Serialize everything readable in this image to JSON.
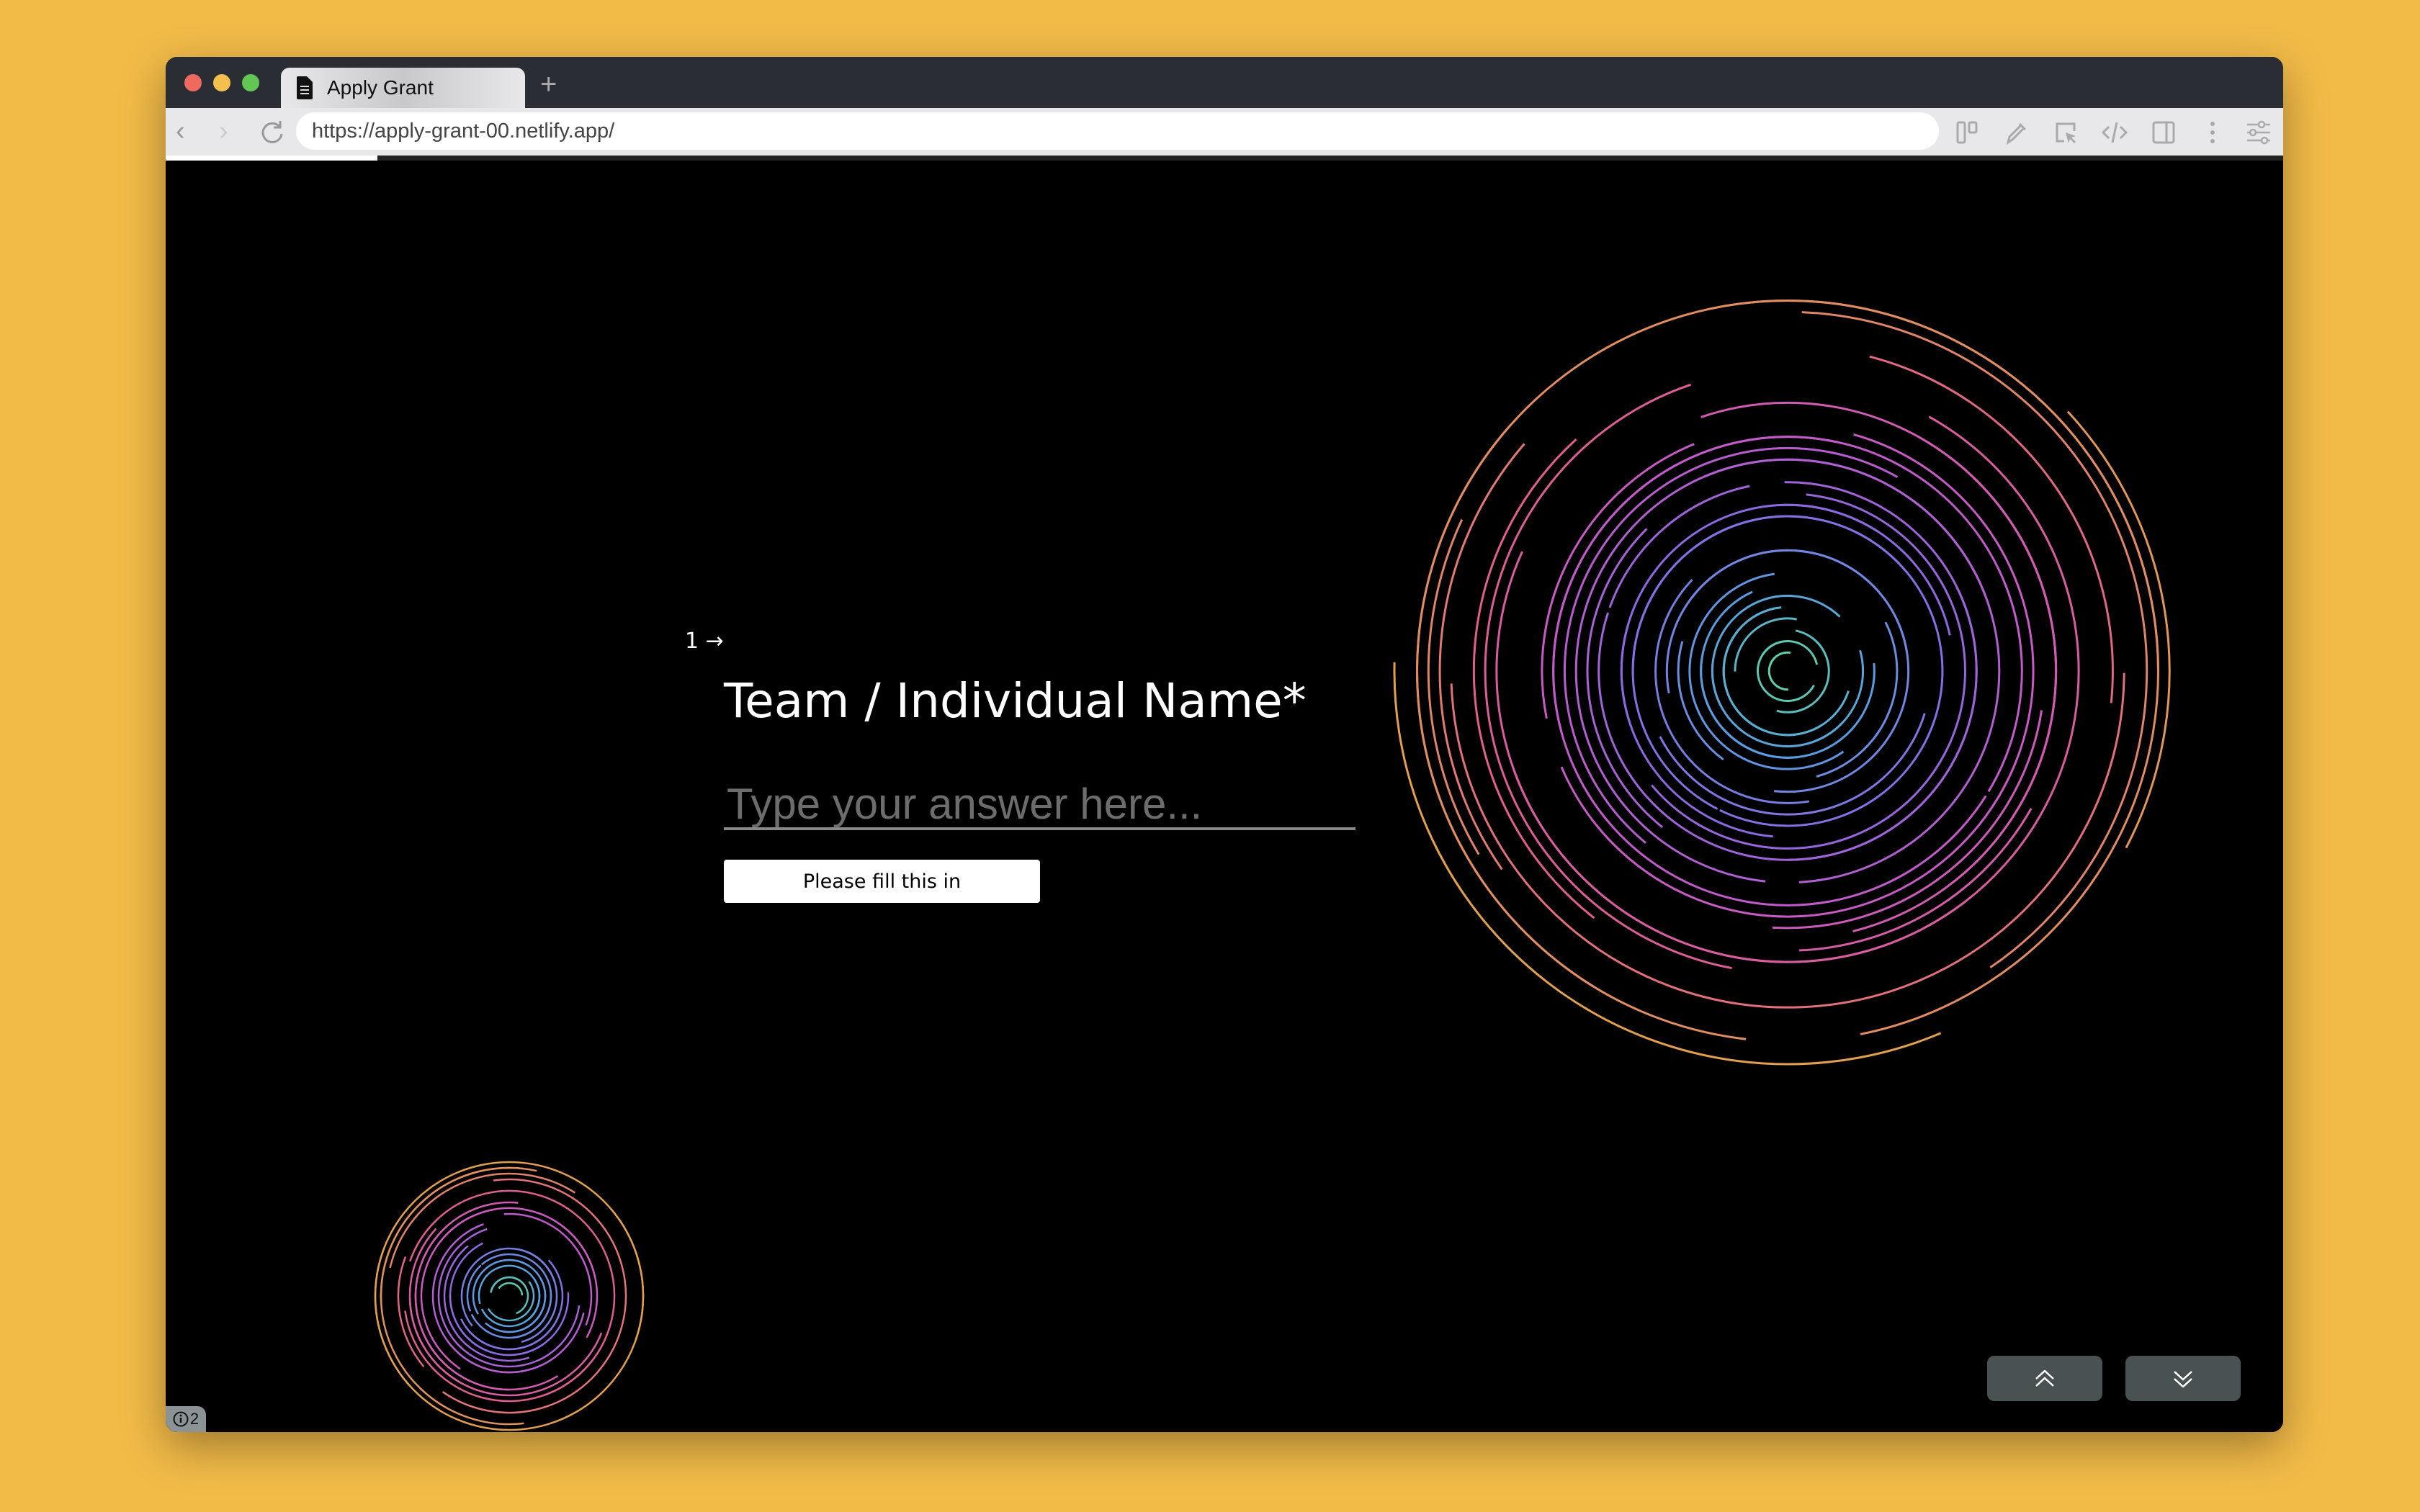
{
  "browser": {
    "tab_title": "Apply Grant",
    "tab_icon": "document-icon",
    "new_tab_label": "+",
    "url": "https://apply-grant-00.netlify.app/",
    "toolbar_icons": [
      "tab-layout-icon",
      "eyedropper-icon",
      "select-element-icon",
      "code-icon",
      "sidebar-icon",
      "more-vertical-icon",
      "sliders-icon"
    ],
    "traffic_lights": {
      "close": "#ee6a5f",
      "minimize": "#f5bf4f",
      "maximize": "#62c655"
    }
  },
  "page_progress_percent": 10,
  "form": {
    "question_number": "1",
    "question_arrow": "→",
    "question_title": "Team / Individual Name*",
    "answer_value": "",
    "answer_placeholder": "Type your answer here...",
    "validation_message": "Please fill this in"
  },
  "navigation": {
    "up_icon": "chevrons-up-icon",
    "down_icon": "chevrons-down-icon"
  },
  "info_badge": {
    "icon": "info-icon",
    "count": "2"
  },
  "decor": {
    "ring_colors": [
      "#5ed6a0",
      "#5a9ee0",
      "#8a6ae0",
      "#c45ac8",
      "#e0608a",
      "#e0a050"
    ]
  }
}
